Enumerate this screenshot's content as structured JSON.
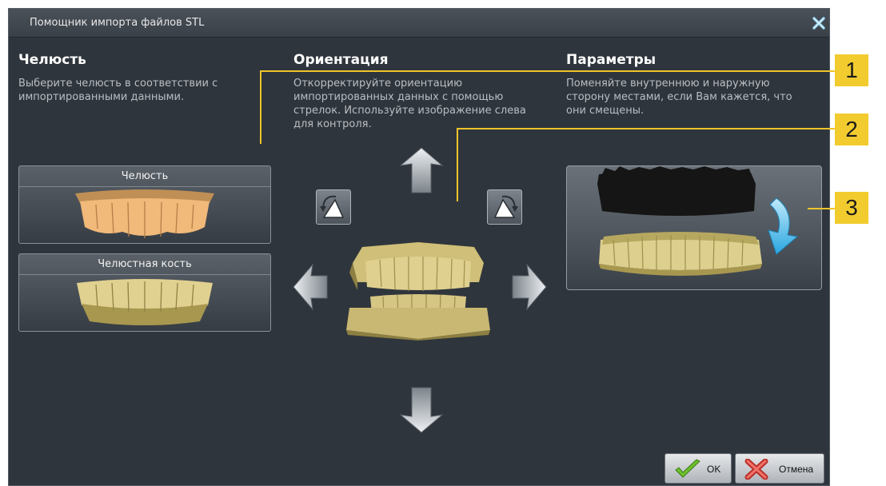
{
  "window": {
    "title": "Помощник импорта файлов STL"
  },
  "jaw": {
    "title": "Челюсть",
    "description": "Выберите челюсть в соответствии с импортированными данными.",
    "options": [
      {
        "label": "Челюсть"
      },
      {
        "label": "Челюстная кость"
      }
    ]
  },
  "orientation": {
    "title": "Ориентация",
    "description": "Откорректируйте ориентацию импортированных данных с помощью стрелок. Используйте изображение слева для контроля."
  },
  "parameters": {
    "title": "Параметры",
    "description": "Поменяйте внутреннюю и наружную сторону местами, если Вам кажется, что они смещены."
  },
  "buttons": {
    "ok": "OK",
    "cancel": "Отмена"
  },
  "callouts": [
    "1",
    "2",
    "3"
  ],
  "colors": {
    "callout": "#f2cc2e",
    "background": "#2f353c",
    "model": "#d8c98a",
    "swap_arrow": "#4fb8e6"
  }
}
